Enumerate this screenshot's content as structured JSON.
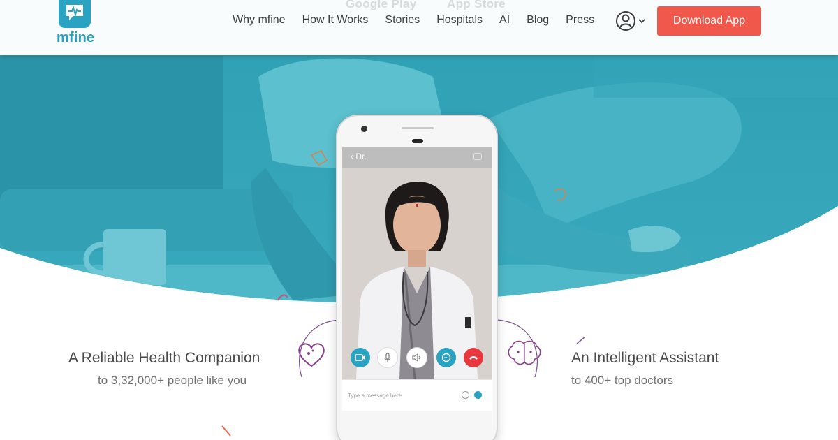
{
  "app": {
    "logo_text": "mfine",
    "logo_icon": "heart-pulse-icon"
  },
  "header": {
    "faded_store_badges": [
      "Google Play",
      "App Store"
    ],
    "nav": [
      "Why mfine",
      "How It Works",
      "Stories",
      "Hospitals",
      "AI",
      "Blog",
      "Press"
    ],
    "account_icon": "user-avatar-icon",
    "account_chevron": "chevron-down-icon",
    "cta_label": "Download App"
  },
  "features": {
    "left": {
      "title": "A Reliable Health Companion",
      "subtitle": "to 3,32,000+ people like you",
      "icon": "heart-icon"
    },
    "right": {
      "title": "An Intelligent Assistant",
      "subtitle": "to 400+ top doctors",
      "icon": "brain-icon"
    }
  },
  "phone": {
    "back_label": "‹ Dr.",
    "call_buttons": [
      {
        "name": "video-icon",
        "color": "#2aa3c3"
      },
      {
        "name": "mic-icon",
        "color": "#ffffff"
      },
      {
        "name": "speaker-icon",
        "color": "#ffffff"
      },
      {
        "name": "chat-icon",
        "color": "#2aa3c3"
      },
      {
        "name": "end-call-icon",
        "color": "#e8383d"
      }
    ],
    "message_placeholder": "Type a message here"
  },
  "colors": {
    "brand": "#2aa3c3",
    "cta": "#f0584b",
    "hero_overlay": "#3ba9bd"
  }
}
